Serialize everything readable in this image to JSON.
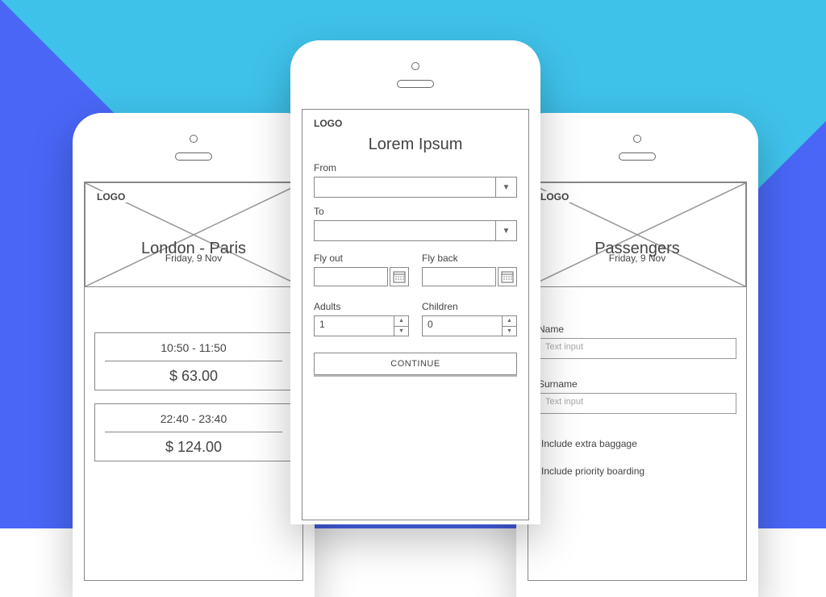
{
  "logo_text": "LOGO",
  "left_phone": {
    "title": "London - Paris",
    "subtitle": "Friday, 9 Nov",
    "flights": [
      {
        "time": "10:50 - 11:50",
        "price": "$ 63.00"
      },
      {
        "time": "22:40 - 23:40",
        "price": "$ 124.00"
      }
    ]
  },
  "center_phone": {
    "title": "Lorem Ipsum",
    "from_label": "From",
    "to_label": "To",
    "flyout_label": "Fly out",
    "flyback_label": "Fly back",
    "adults_label": "Adults",
    "children_label": "Children",
    "adults_value": "1",
    "children_value": "0",
    "continue_label": "CONTINUE"
  },
  "right_phone": {
    "title": "Passengers",
    "subtitle": "Friday, 9 Nov",
    "name_label": "Name",
    "surname_label": "Surname",
    "placeholder": "Text input",
    "option1": "Include extra baggage",
    "option2": "Include priority boarding"
  }
}
